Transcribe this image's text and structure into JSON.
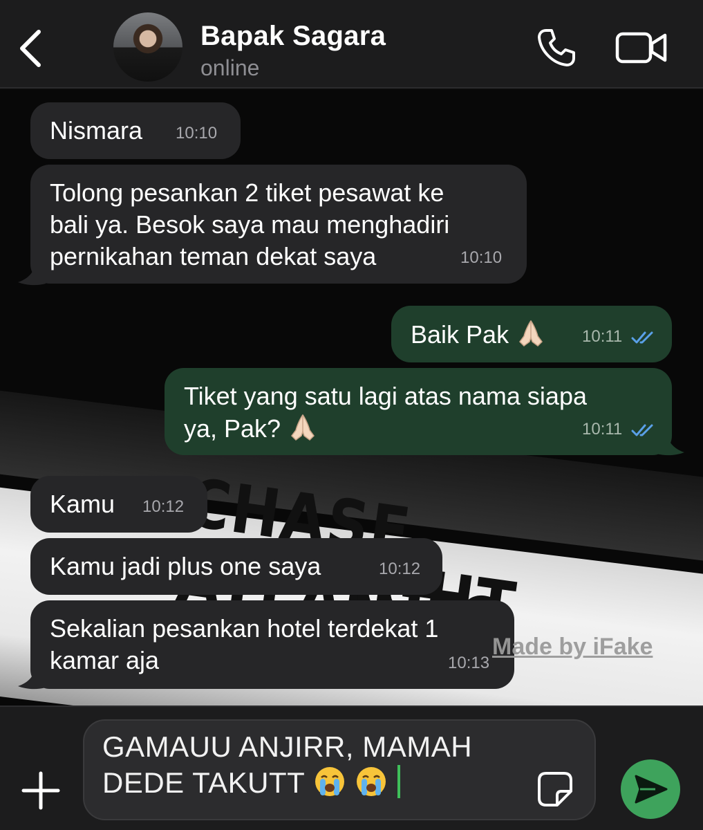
{
  "header": {
    "name": "Bapak Sagara",
    "status": "online"
  },
  "messages": [
    {
      "direction": "incoming",
      "text": "Nismara",
      "time": "10:10"
    },
    {
      "direction": "incoming",
      "lines": [
        "Tolong pesankan 2 tiket pesawat ke",
        "bali ya. Besok saya mau menghadiri",
        "pernikahan teman dekat saya"
      ],
      "time": "10:10"
    },
    {
      "direction": "outgoing",
      "text": "Baik Pak",
      "emoji": "folded-hands",
      "time": "10:11",
      "status": "read"
    },
    {
      "direction": "outgoing",
      "lines": [
        "Tiket yang satu lagi atas nama siapa",
        "ya, Pak?"
      ],
      "emoji": "folded-hands",
      "time": "10:11",
      "status": "read"
    },
    {
      "direction": "incoming",
      "text": "Kamu",
      "time": "10:12"
    },
    {
      "direction": "incoming",
      "text": "Kamu jadi plus one saya",
      "time": "10:12"
    },
    {
      "direction": "incoming",
      "lines": [
        "Sekalian pesankan hotel terdekat 1",
        "kamar aja"
      ],
      "time": "10:13"
    }
  ],
  "wallpaper": {
    "line1": "CHASE ATLANTIC",
    "line2": "IGHT"
  },
  "watermark": "Made by iFake",
  "composer": {
    "line1": "GAMAUU ANJIRR, MAMAH",
    "line2": "DEDE TAKUTT",
    "emoji": "loudly-crying-face x2"
  },
  "colors": {
    "header_bg": "#1c1c1d",
    "incoming_bubble": "#262628",
    "outgoing_bubble": "#1f3f2c",
    "read_ticks": "#5aa0e8",
    "send_button": "#3ea35c",
    "caret": "#3fbf5a"
  },
  "icons": [
    "chevron-left-icon",
    "phone-icon",
    "video-camera-icon",
    "double-check-icon",
    "plus-icon",
    "sticker-icon",
    "send-icon"
  ]
}
